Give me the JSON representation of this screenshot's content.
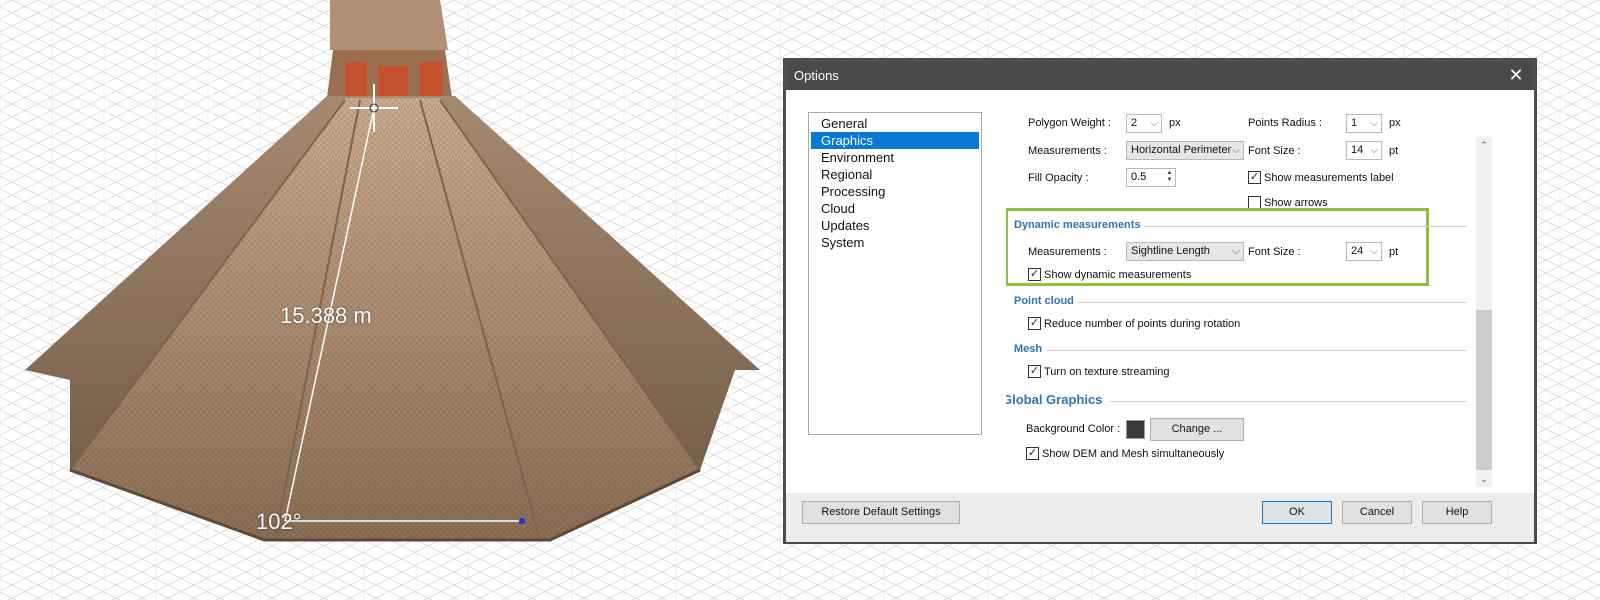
{
  "scene": {
    "distance_label": "15.388 m",
    "angle_label": "102°"
  },
  "dialog": {
    "title": "Options",
    "close_icon": "close-icon",
    "nav": [
      "General",
      "Graphics",
      "Environment",
      "Regional",
      "Processing",
      "Cloud",
      "Updates",
      "System"
    ],
    "nav_selected": "Graphics",
    "polygon": {
      "weight_label": "Polygon Weight :",
      "weight_value": "2",
      "weight_unit": "px",
      "points_radius_label": "Points Radius :",
      "points_radius_value": "1",
      "points_radius_unit": "px",
      "measurements_label": "Measurements :",
      "measurements_value": "Horizontal Perimeter",
      "font_size_label": "Font Size :",
      "font_size_value": "14",
      "font_size_unit": "pt",
      "fill_opacity_label": "Fill Opacity :",
      "fill_opacity_value": "0.5",
      "show_label": "Show measurements label",
      "show_label_checked": true,
      "show_arrows": "Show arrows",
      "show_arrows_checked": false
    },
    "dynamic": {
      "title": "Dynamic measurements",
      "measurements_label": "Measurements :",
      "measurements_value": "Sightline Length",
      "font_size_label": "Font Size :",
      "font_size_value": "24",
      "font_size_unit": "pt",
      "show_dynamic": "Show dynamic measurements",
      "show_dynamic_checked": true
    },
    "point_cloud": {
      "title": "Point cloud",
      "reduce_points": "Reduce number of points during rotation",
      "reduce_points_checked": true
    },
    "mesh": {
      "title": "Mesh",
      "texture_streaming": "Turn on texture streaming",
      "texture_streaming_checked": true
    },
    "global": {
      "title": "Global Graphics",
      "bg_color_label": "Background Color :",
      "bg_color": "#3a3a3a",
      "change_button": "Change ...",
      "show_dem_mesh": "Show DEM and Mesh simultaneously",
      "show_dem_mesh_checked": true
    },
    "footer": {
      "restore": "Restore Default Settings",
      "ok": "OK",
      "cancel": "Cancel",
      "help": "Help"
    }
  },
  "colors": {
    "accent": "#0a78d7",
    "section": "#2e74b5",
    "highlight": "#8cc043",
    "titlebar": "#4a4a4a"
  }
}
